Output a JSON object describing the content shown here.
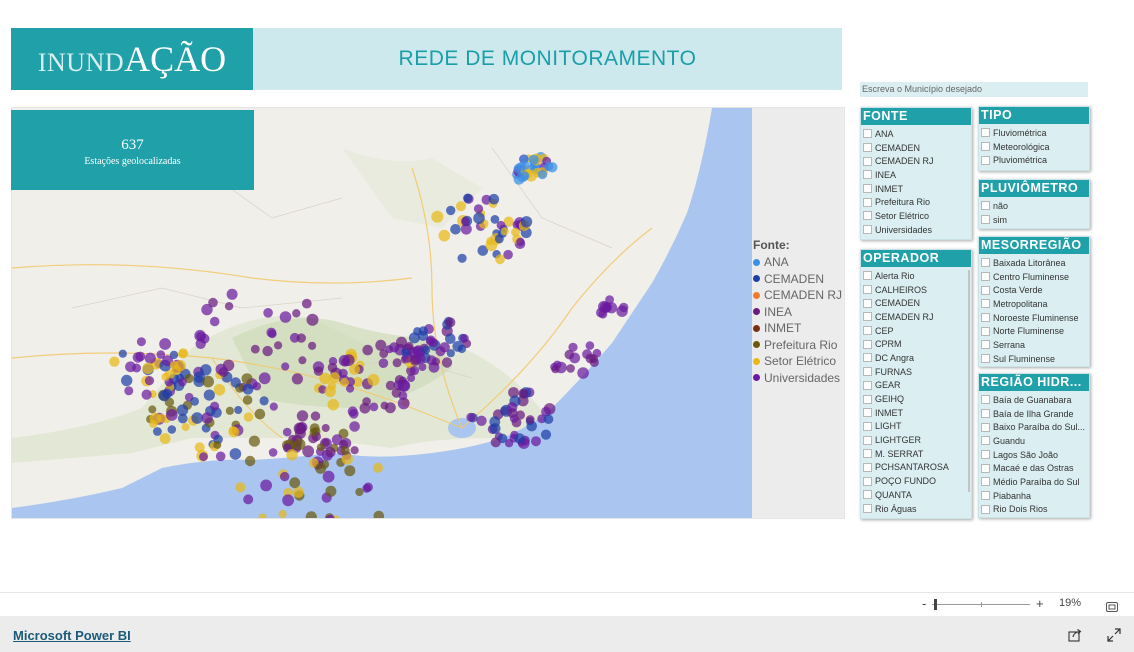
{
  "header": {
    "logo_light": "INUND",
    "logo_bold": "AÇÃO",
    "title": "REDE DE MONITORAMENTO"
  },
  "kpi": {
    "value": "637",
    "label": "Estações geolocalizadas"
  },
  "legend": {
    "title": "Fonte:",
    "items": [
      {
        "label": "ANA",
        "color": "#3a8fe8"
      },
      {
        "label": "CEMADEN",
        "color": "#1f3fa8"
      },
      {
        "label": "CEMADEN RJ",
        "color": "#f07a30"
      },
      {
        "label": "INEA",
        "color": "#6a1a80"
      },
      {
        "label": "INMET",
        "color": "#7a3010"
      },
      {
        "label": "Prefeitura Rio",
        "color": "#6a5a10"
      },
      {
        "label": "Setor Elétrico",
        "color": "#e8b818"
      },
      {
        "label": "Universidades",
        "color": "#6a1aa0"
      }
    ]
  },
  "search": {
    "placeholder": "Escreva o Município desejado"
  },
  "slicers": {
    "fonte": {
      "title": "FONTE",
      "items": [
        "ANA",
        "CEMADEN",
        "CEMADEN RJ",
        "INEA",
        "INMET",
        "Prefeitura Rio",
        "Setor Elétrico",
        "Universidades"
      ]
    },
    "operador": {
      "title": "OPERADOR",
      "items": [
        "Alerta Rio",
        "CALHEIROS",
        "CEMADEN",
        "CEMADEN RJ",
        "CEP",
        "CPRM",
        "DC Angra",
        "FURNAS",
        "GEAR",
        "GEIHQ",
        "INMET",
        "LIGHT",
        "LIGHTGER",
        "M. SERRAT",
        "PCHSANTAROSA",
        "POÇO FUNDO",
        "QUANTA",
        "Rio Águas"
      ]
    },
    "tipo": {
      "title": "TIPO",
      "items": [
        "Fluviométrica",
        "Meteorológica",
        "Pluviométrica"
      ]
    },
    "pluviometro": {
      "title": "PLUVIÔMETRO",
      "items": [
        "não",
        "sim"
      ]
    },
    "mesorregiao": {
      "title": "MESORREGIÃO",
      "items": [
        "Baixada Litorânea",
        "Centro Fluminense",
        "Costa Verde",
        "Metropolitana",
        "Noroeste Fluminense",
        "Norte Fluminense",
        "Serrana",
        "Sul Fluminense"
      ]
    },
    "regiao": {
      "title": "REGIÃO HIDR...",
      "items": [
        "Baía de Guanabara",
        "Baía de Ilha Grande",
        "Baixo Paraíba do Sul...",
        "Guandu",
        "Lagos São João",
        "Macaé e das Ostras",
        "Médio Paraíba do Sul",
        "Piabanha",
        "Rio Dois Rios"
      ]
    }
  },
  "zoom": {
    "minus": "-",
    "plus": "+",
    "value": "19%"
  },
  "footer": {
    "link": "Microsoft Power BI"
  },
  "icons": {
    "fit": "fit-to-page-icon",
    "share": "share-icon",
    "expand": "expand-icon"
  }
}
